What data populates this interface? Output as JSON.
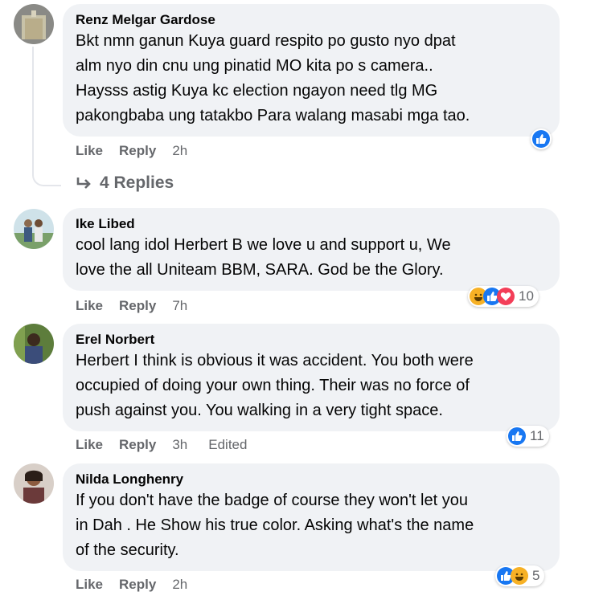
{
  "thread": {
    "replies_label": "4 Replies"
  },
  "comments": [
    {
      "author": "Renz Melgar Gardose",
      "lines": [
        "Bkt nmn ganun Kuya guard respito po gusto nyo dpat",
        "alm nyo din cnu ung pinatid MO kita po s camera..",
        "Haysss astig Kuya kc election ngayon need tlg MG",
        "pakongbaba ung tatakbo Para walang masabi mga tao."
      ],
      "like": "Like",
      "reply": "Reply",
      "time": "2h",
      "reactions": [
        "like-icon"
      ],
      "reaction_count": ""
    },
    {
      "author": "Ike Libed",
      "lines": [
        "cool lang idol Herbert B we love u and support u, We",
        "love the all Uniteam BBM, SARA. God be the Glory."
      ],
      "like": "Like",
      "reply": "Reply",
      "time": "7h",
      "reactions": [
        "haha-icon",
        "like-icon",
        "love-icon"
      ],
      "reaction_count": "10"
    },
    {
      "author": "Erel Norbert",
      "lines": [
        "Herbert I think is obvious it was accident. You both were",
        "occupied of doing your own thing. Their was no force of",
        "push against you. You walking in a very tight space."
      ],
      "like": "Like",
      "reply": "Reply",
      "time": "3h",
      "edited": "Edited",
      "reactions": [
        "like-icon"
      ],
      "reaction_count": "11"
    },
    {
      "author": "Nilda Longhenry",
      "lines": [
        "If you don't have the badge of course they won't let you",
        "in Dah . He Show his true color. Asking what's the name",
        "of the security."
      ],
      "like": "Like",
      "reply": "Reply",
      "time": "2h",
      "reactions": [
        "like-icon",
        "haha-icon"
      ],
      "reaction_count": "5"
    }
  ],
  "colors": {
    "bubble": "#f0f2f5",
    "like_blue": "#1877f2",
    "love_red": "#f33e58",
    "haha_yellow": "#f7b125",
    "meta_gray": "#65676b"
  }
}
